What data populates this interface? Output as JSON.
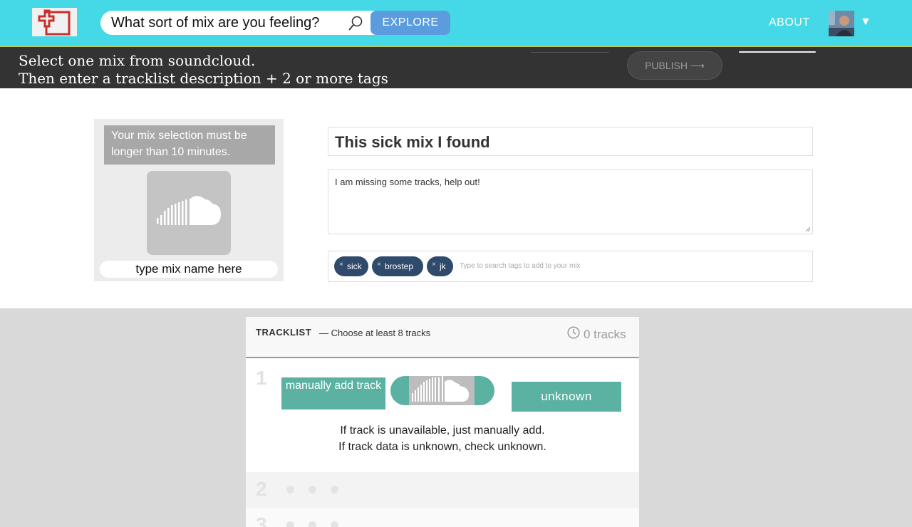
{
  "header": {
    "search_placeholder": "What sort of mix are you feeling?",
    "explore_label": "EXPLORE",
    "about_label": "ABOUT",
    "account_caret": "▼"
  },
  "instructions": {
    "line1": "Select one mix from soundcloud.",
    "line2": "Then enter a tracklist description + 2 or more tags",
    "publish_label": "PUBLISH ⟶"
  },
  "mix_card": {
    "notice": "Your mix selection must be longer than 10 minutes.",
    "name_placeholder": "type mix name here"
  },
  "form": {
    "title_value": "This sick mix I found",
    "description_value": "I am missing some tracks, help out!",
    "tags": [
      "sick",
      "brostep",
      "jk"
    ],
    "tag_remove_symbol": "×",
    "tag_placeholder": "Type to search tags to add to your mix"
  },
  "tracklist": {
    "title": "TRACKLIST",
    "subtitle": "— Choose at least 8 tracks",
    "track_count": "0 tracks",
    "rows": [
      {
        "number": "1",
        "manual_label": "manually add track",
        "unknown_label": "unknown",
        "help_line1": "If track is unavailable, just manually add.",
        "help_line2": "If track data is unknown, check unknown."
      },
      {
        "number": "2"
      },
      {
        "number": "3"
      }
    ]
  },
  "colors": {
    "header_bg": "#45d8e6",
    "explore_bg": "#5a9cde",
    "dark_bar": "#333333",
    "tag_bg": "#2f4a6a",
    "teal_button": "#5bb2a2"
  }
}
